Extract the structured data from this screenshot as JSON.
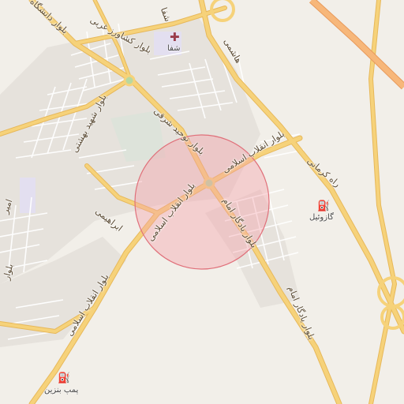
{
  "map": {
    "search_circle_color": "#f4a0a8",
    "road_color": "#f6d27a",
    "labels": {
      "daneshgah": "بلوار دانشگاه",
      "shafa": "شفا",
      "keshavarz": "بلوار کشاورز غربی",
      "hashemi": "هاشمی",
      "shahid_beheshti": "بلوار شهید بهشتی",
      "tohid": "بلوار توحید شرقی",
      "enghelab_ne": "بلوار انقلاب اسلامی",
      "kermani": "راه کرمانی",
      "amir": "امیر",
      "ebrahimi": "ابراهیمی",
      "enghelab_c": "بلوار انقلاب اسلامی",
      "yadegar_c": "بلوار یادگار امام",
      "yadegar_s": "بلوار یادگار امام",
      "enghelab_sw": "بلوار انقلاب اسلامی",
      "bolvar_w": "بلوار"
    },
    "pois": {
      "hospital": "شفا",
      "gas_station_east": "گازوئیل",
      "gas_station_south": "پمپ بنزین"
    }
  }
}
